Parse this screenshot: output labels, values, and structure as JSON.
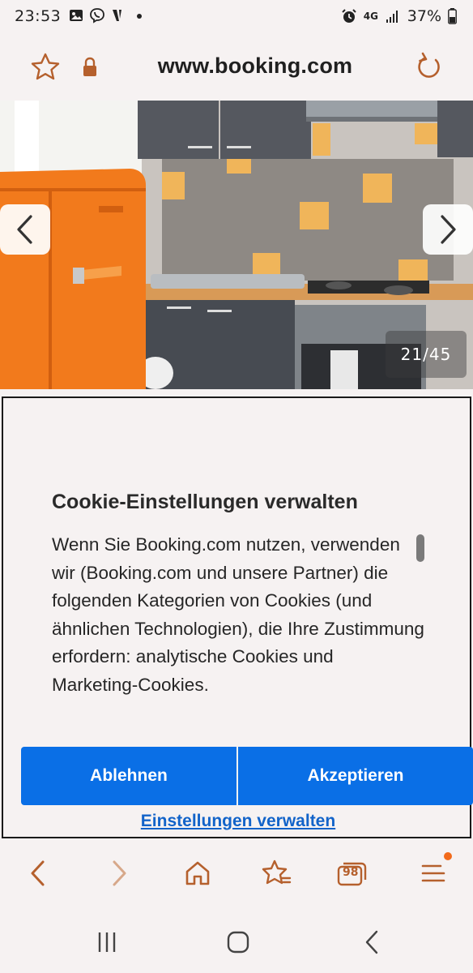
{
  "status_bar": {
    "time": "23:53",
    "network": "4G",
    "battery": "37%",
    "left_icons": [
      "gallery-icon",
      "viber-icon",
      "v-app-icon",
      "dot-icon"
    ],
    "right_icons": [
      "alarm-icon",
      "4g-data-icon",
      "signal-icon",
      "battery-icon"
    ]
  },
  "browser": {
    "url": "www.booking.com",
    "accent": "#b5602d"
  },
  "gallery": {
    "counter": "21/45",
    "prev_icon": "chevron-left-icon",
    "next_icon": "chevron-right-icon"
  },
  "cookie_dialog": {
    "title": "Cookie-Einstellungen verwalten",
    "body": "Wenn Sie Booking.com nutzen, verwenden wir (Booking.com und unsere Partner) die folgenden Kategorien von Cookies (und ähnlichen Technologien), die Ihre Zustimmung erfordern: analytische Cookies und Marketing-Cookies.",
    "reject_label": "Ablehnen",
    "accept_label": "Akzeptieren",
    "manage_label": "Einstellungen verwalten",
    "button_color": "#0a6fe6"
  },
  "bottom_nav": {
    "tabs_count": "98",
    "items": [
      "back-icon",
      "forward-icon",
      "home-icon",
      "bookmarks-icon",
      "tabs-icon",
      "menu-icon"
    ]
  },
  "system_nav": {
    "items": [
      "recents-icon",
      "home-icon",
      "back-icon"
    ]
  }
}
